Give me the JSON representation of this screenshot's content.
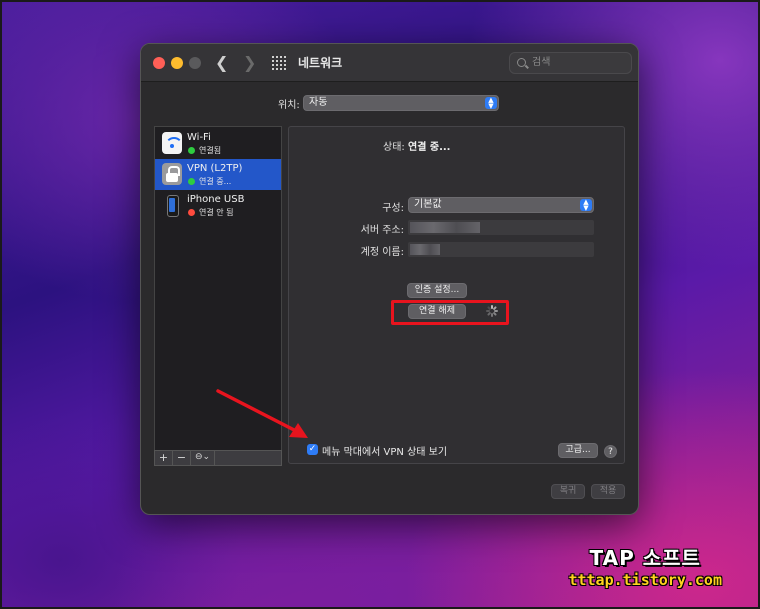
{
  "window": {
    "title": "네트워크",
    "search_placeholder": "검색"
  },
  "location": {
    "label": "위치:",
    "value": "자동"
  },
  "sidebar": {
    "items": [
      {
        "name": "Wi-Fi",
        "status": "연결됨",
        "status_color": "#2ecc40",
        "icon": "wifi-icon",
        "selected": false
      },
      {
        "name": "VPN (L2TP)",
        "status": "연결 중...",
        "status_color": "#2ecc40",
        "icon": "lock-icon",
        "selected": true
      },
      {
        "name": "iPhone USB",
        "status": "연결 안 됨",
        "status_color": "#ff4b3e",
        "icon": "phone-icon",
        "selected": false
      }
    ],
    "toolbar": {
      "add": "+",
      "remove": "−",
      "action": "⊖⌄"
    }
  },
  "detail": {
    "status_label": "상태:",
    "status_value": "연결 중...",
    "config_label": "구성:",
    "config_value": "기본값",
    "server_label": "서버 주소:",
    "server_value": "",
    "account_label": "계정 이름:",
    "account_value": "",
    "auth_button": "인증 설정...",
    "disconnect_button": "연결 해제",
    "show_vpn_label": "메뉴 막대에서 VPN 상태 보기",
    "show_vpn_checked": true,
    "advanced_button": "고급...",
    "help_button": "?"
  },
  "footer": {
    "revert_button": "복귀",
    "apply_button": "적용"
  },
  "watermark": {
    "title": "TAP 소프트",
    "url": "tttap.tistory.com"
  },
  "colors": {
    "accent": "#2e7cf6",
    "selection": "#2357c9",
    "highlight_box": "#e8141e",
    "annotation_arrow": "#e8141e"
  }
}
